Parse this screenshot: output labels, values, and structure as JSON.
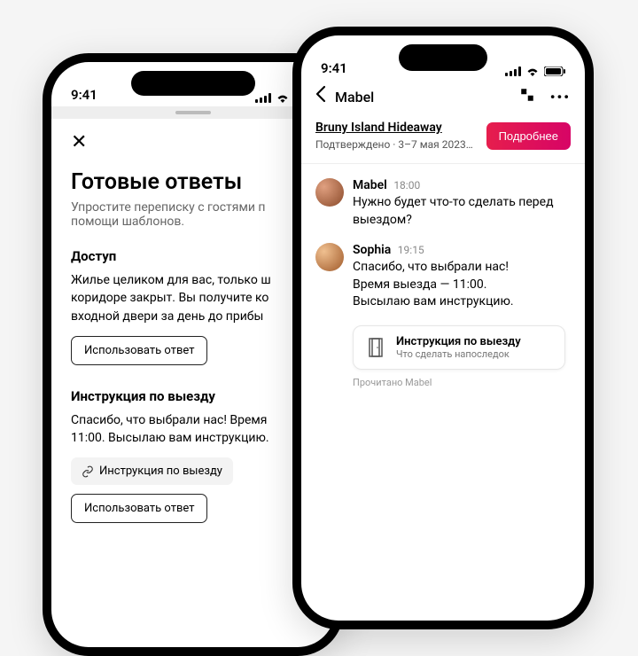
{
  "status": {
    "time": "9:41"
  },
  "left": {
    "title": "Готовые ответы",
    "subtitle": "Упростите переписку с гостями п\nпомощи шаблонов.",
    "sections": [
      {
        "title": "Доступ",
        "body": "Жилье целиком для вас, только ш\nкоридоре закрыт. Вы получите ко\nвходной двери за день до прибы",
        "use_btn": "Использовать ответ"
      },
      {
        "title": "Инструкция по выезду",
        "body": "Спасибо, что выбрали нас! Время\n11:00. Высылаю вам инструкцию.",
        "chip": "Инструкция по выезду",
        "use_btn": "Использовать ответ"
      }
    ]
  },
  "right": {
    "nav_title": "Mabel",
    "listing": {
      "title": "Bruny Island Hideaway",
      "subtitle": "Подтверждено · 3–7 мая 2023…",
      "details_btn": "Подробнее"
    },
    "messages": [
      {
        "name": "Mabel",
        "time": "18:00",
        "text": "Нужно будет что-то сделать перед выездом?"
      },
      {
        "name": "Sophia",
        "time": "19:15",
        "text": "Спасибо, что выбрали нас!\nВремя выезда — 11:00.\nВысылаю вам инструкцию."
      }
    ],
    "attachment": {
      "title": "Инструкция по выезду",
      "subtitle": "Что сделать напоследок"
    },
    "read_receipt": "Прочитано Mabel"
  }
}
